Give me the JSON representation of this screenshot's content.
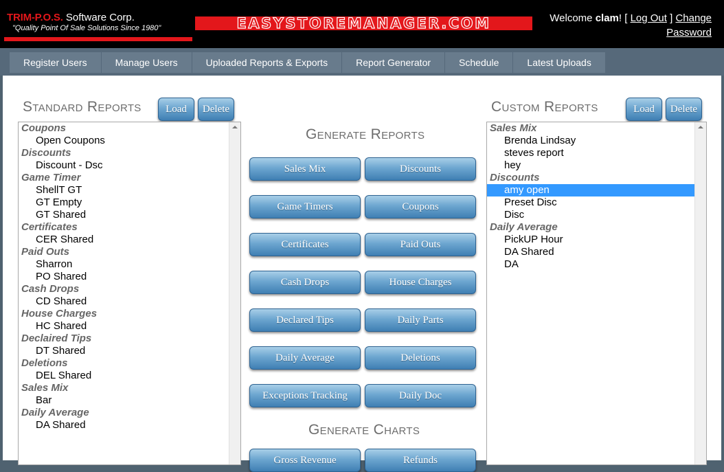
{
  "header": {
    "logo_brand": "TRIM-P.O.S.",
    "logo_company": " Software Corp.",
    "logo_tagline": "\"Quality Point Of Sale Solutions Since 1980\"",
    "banner_text": "EASYSTOREMANAGER.COM",
    "welcome_prefix": "Welcome ",
    "username": "clam",
    "welcome_suffix": "! [ ",
    "logout_label": "Log Out",
    "separator": " ] ",
    "change_password_label": "Change Password"
  },
  "nav": {
    "items": [
      {
        "label": "Register Users"
      },
      {
        "label": "Manage Users"
      },
      {
        "label": "Uploaded Reports & Exports"
      },
      {
        "label": "Report Generator"
      },
      {
        "label": "Schedule"
      },
      {
        "label": "Latest Uploads"
      }
    ]
  },
  "standard_reports": {
    "title": "Standard Reports",
    "load_label": "Load",
    "delete_label": "Delete",
    "groups": [
      {
        "label": "Coupons",
        "items": [
          "Open Coupons"
        ]
      },
      {
        "label": "Discounts",
        "items": [
          "Discount - Dsc"
        ]
      },
      {
        "label": "Game Timer",
        "items": [
          "ShellT GT",
          "GT Empty",
          "GT Shared"
        ]
      },
      {
        "label": "Certificates",
        "items": [
          "CER Shared"
        ]
      },
      {
        "label": "Paid Outs",
        "items": [
          "Sharron",
          "PO Shared"
        ]
      },
      {
        "label": "Cash Drops",
        "items": [
          "CD Shared"
        ]
      },
      {
        "label": "House Charges",
        "items": [
          "HC Shared"
        ]
      },
      {
        "label": "Declaired Tips",
        "items": [
          "DT Shared"
        ]
      },
      {
        "label": "Deletions",
        "items": [
          "DEL Shared"
        ]
      },
      {
        "label": "Sales Mix",
        "items": [
          "Bar"
        ]
      },
      {
        "label": "Daily Average",
        "items": [
          "DA Shared"
        ]
      }
    ]
  },
  "generate": {
    "reports_title": "Generate Reports",
    "report_buttons": [
      "Sales Mix",
      "Discounts",
      "Game Timers",
      "Coupons",
      "Certificates",
      "Paid Outs",
      "Cash Drops",
      "House Charges",
      "Declared Tips",
      "Daily Parts",
      "Daily Average",
      "Deletions",
      "Exceptions Tracking",
      "Daily Doc"
    ],
    "charts_title": "Generate Charts",
    "chart_buttons": [
      "Gross Revenue",
      "Refunds"
    ]
  },
  "custom_reports": {
    "title": "Custom Reports",
    "load_label": "Load",
    "delete_label": "Delete",
    "selected": "amy open",
    "groups": [
      {
        "label": "Sales Mix",
        "items": [
          "Brenda Lindsay",
          "steves report",
          "hey"
        ]
      },
      {
        "label": "Discounts",
        "items": [
          "amy open",
          "Preset Disc",
          "Disc"
        ]
      },
      {
        "label": "Daily Average",
        "items": [
          "PickUP Hour",
          "DA Shared",
          "DA"
        ]
      }
    ]
  },
  "colors": {
    "header_bg": "#000000",
    "brand_red": "#e3171b",
    "nav_bg": "#56697a",
    "nav_item_bg": "#687b8c",
    "button_blue": "#3f7fb3",
    "selection": "#3399ff"
  }
}
